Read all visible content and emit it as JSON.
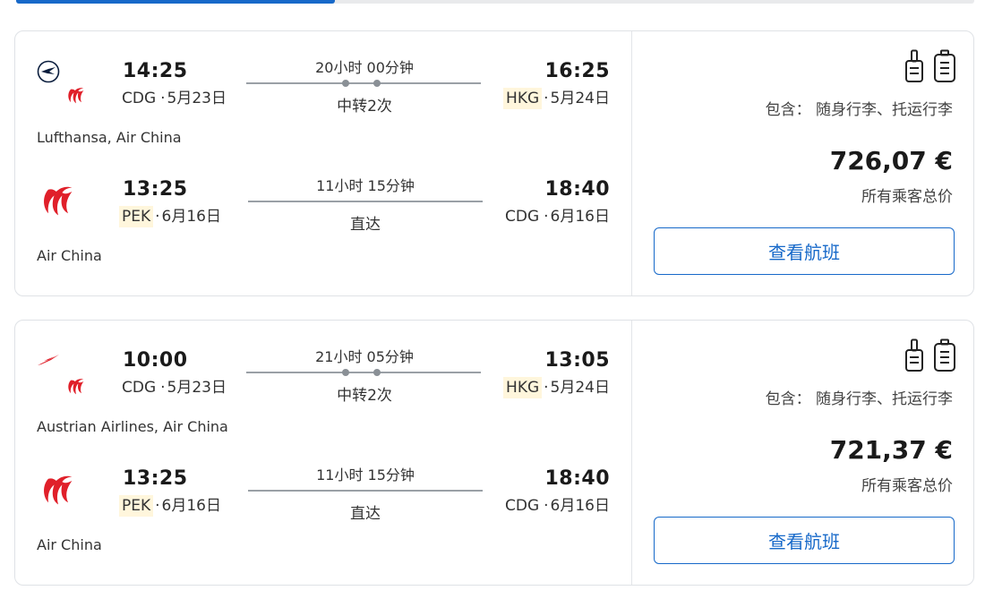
{
  "results": [
    {
      "outbound": {
        "depart_time": "14:25",
        "depart_code": "CDG",
        "depart_date": "5月23日",
        "duration": "20小时 00分钟",
        "stops": "中转2次",
        "arrive_time": "16:25",
        "arrive_code": "HKG",
        "arrive_date": "5月24日",
        "airlines": "Lufthansa, Air China"
      },
      "inbound": {
        "depart_time": "13:25",
        "depart_code": "PEK",
        "depart_date": "6月16日",
        "duration": "11小时 15分钟",
        "stops": "直达",
        "arrive_time": "18:40",
        "arrive_code": "CDG",
        "arrive_date": "6月16日",
        "airlines": "Air China"
      },
      "included_label": "包含：",
      "included_items": "随身行李、托运行李",
      "price": "726,07 €",
      "price_note": "所有乘客总价",
      "button_label": "查看航班"
    },
    {
      "outbound": {
        "depart_time": "10:00",
        "depart_code": "CDG",
        "depart_date": "5月23日",
        "duration": "21小时 05分钟",
        "stops": "中转2次",
        "arrive_time": "13:05",
        "arrive_code": "HKG",
        "arrive_date": "5月24日",
        "airlines": "Austrian Airlines, Air China"
      },
      "inbound": {
        "depart_time": "13:25",
        "depart_code": "PEK",
        "depart_date": "6月16日",
        "duration": "11小时 15分钟",
        "stops": "直达",
        "arrive_time": "18:40",
        "arrive_code": "CDG",
        "arrive_date": "6月16日",
        "airlines": "Air China"
      },
      "included_label": "包含：",
      "included_items": "随身行李、托运行李",
      "price": "721,37 €",
      "price_note": "所有乘客总价",
      "button_label": "查看航班"
    }
  ],
  "icons": [
    "lufthansa-logo-icon",
    "air-china-logo-icon",
    "austrian-airlines-logo-icon",
    "carry-on-bag-icon",
    "checked-bag-icon"
  ],
  "colors": {
    "accent": "#1769c9",
    "air_china_red": "#e0202a",
    "airport_highlight": "#fff6dc",
    "lufthansa_navy": "#0a1d3d"
  }
}
